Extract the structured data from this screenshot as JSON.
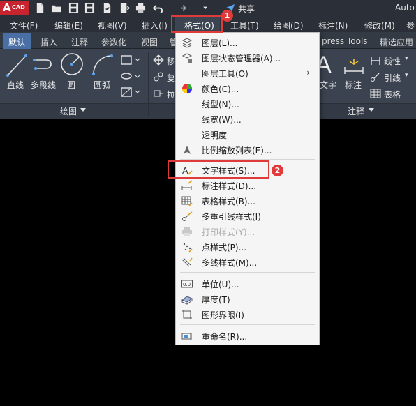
{
  "titlebar": {
    "logo_letter": "A",
    "logo_text": "CAD",
    "share_label": "共享",
    "app_title": "Auto"
  },
  "menubar": {
    "items": [
      "文件(F)",
      "编辑(E)",
      "视图(V)",
      "插入(I)",
      "格式(O)",
      "工具(T)",
      "绘图(D)",
      "标注(N)",
      "修改(M)",
      "参"
    ]
  },
  "tabs": {
    "items": [
      "默认",
      "插入",
      "注释",
      "参数化",
      "视图",
      "管",
      "press Tools",
      "精选应用"
    ]
  },
  "ribbon": {
    "draw_tools": [
      "直线",
      "多段线",
      "圆",
      "圆弧"
    ],
    "modify_partial": [
      "移",
      "复",
      "拉"
    ],
    "annot_tools": [
      "文字",
      "标注"
    ],
    "annot_right": [
      "线性",
      "引线",
      "表格"
    ],
    "panel_draw": "绘图",
    "panel_annot": "注释"
  },
  "format_menu": {
    "items": [
      {
        "label": "图层(L)...",
        "icon": "layer-icon",
        "disabled": false
      },
      {
        "label": "图层状态管理器(A)...",
        "icon": "layer-state-icon",
        "disabled": false
      },
      {
        "label": "图层工具(O)",
        "icon": "",
        "disabled": false,
        "submenu": true
      },
      {
        "label": "颜色(C)...",
        "icon": "color-wheel-icon",
        "disabled": false
      },
      {
        "label": "线型(N)...",
        "icon": "",
        "disabled": false
      },
      {
        "label": "线宽(W)...",
        "icon": "",
        "disabled": false
      },
      {
        "label": "透明度",
        "icon": "",
        "disabled": false
      },
      {
        "label": "比例缩放列表(E)...",
        "icon": "scale-list-icon",
        "disabled": false
      },
      {
        "label": "文字样式(S)...",
        "icon": "text-style-icon",
        "disabled": false
      },
      {
        "label": "标注样式(D)...",
        "icon": "dim-style-icon",
        "disabled": false
      },
      {
        "label": "表格样式(B)...",
        "icon": "table-style-icon",
        "disabled": false
      },
      {
        "label": "多重引线样式(I)",
        "icon": "mleader-style-icon",
        "disabled": false
      },
      {
        "label": "打印样式(Y)...",
        "icon": "plot-style-icon",
        "disabled": true
      },
      {
        "label": "点样式(P)...",
        "icon": "point-style-icon",
        "disabled": false
      },
      {
        "label": "多线样式(M)...",
        "icon": "mline-style-icon",
        "disabled": false
      },
      {
        "label": "单位(U)...",
        "icon": "units-icon",
        "disabled": false
      },
      {
        "label": "厚度(T)",
        "icon": "thickness-icon",
        "disabled": false
      },
      {
        "label": "图形界限(I)",
        "icon": "limits-icon",
        "disabled": false
      },
      {
        "label": "重命名(R)...",
        "icon": "rename-icon",
        "disabled": false
      }
    ],
    "submenu_arrow": "›"
  },
  "annotations": {
    "badge_1": "1",
    "badge_2": "2",
    "accent": "#e03b3b"
  }
}
